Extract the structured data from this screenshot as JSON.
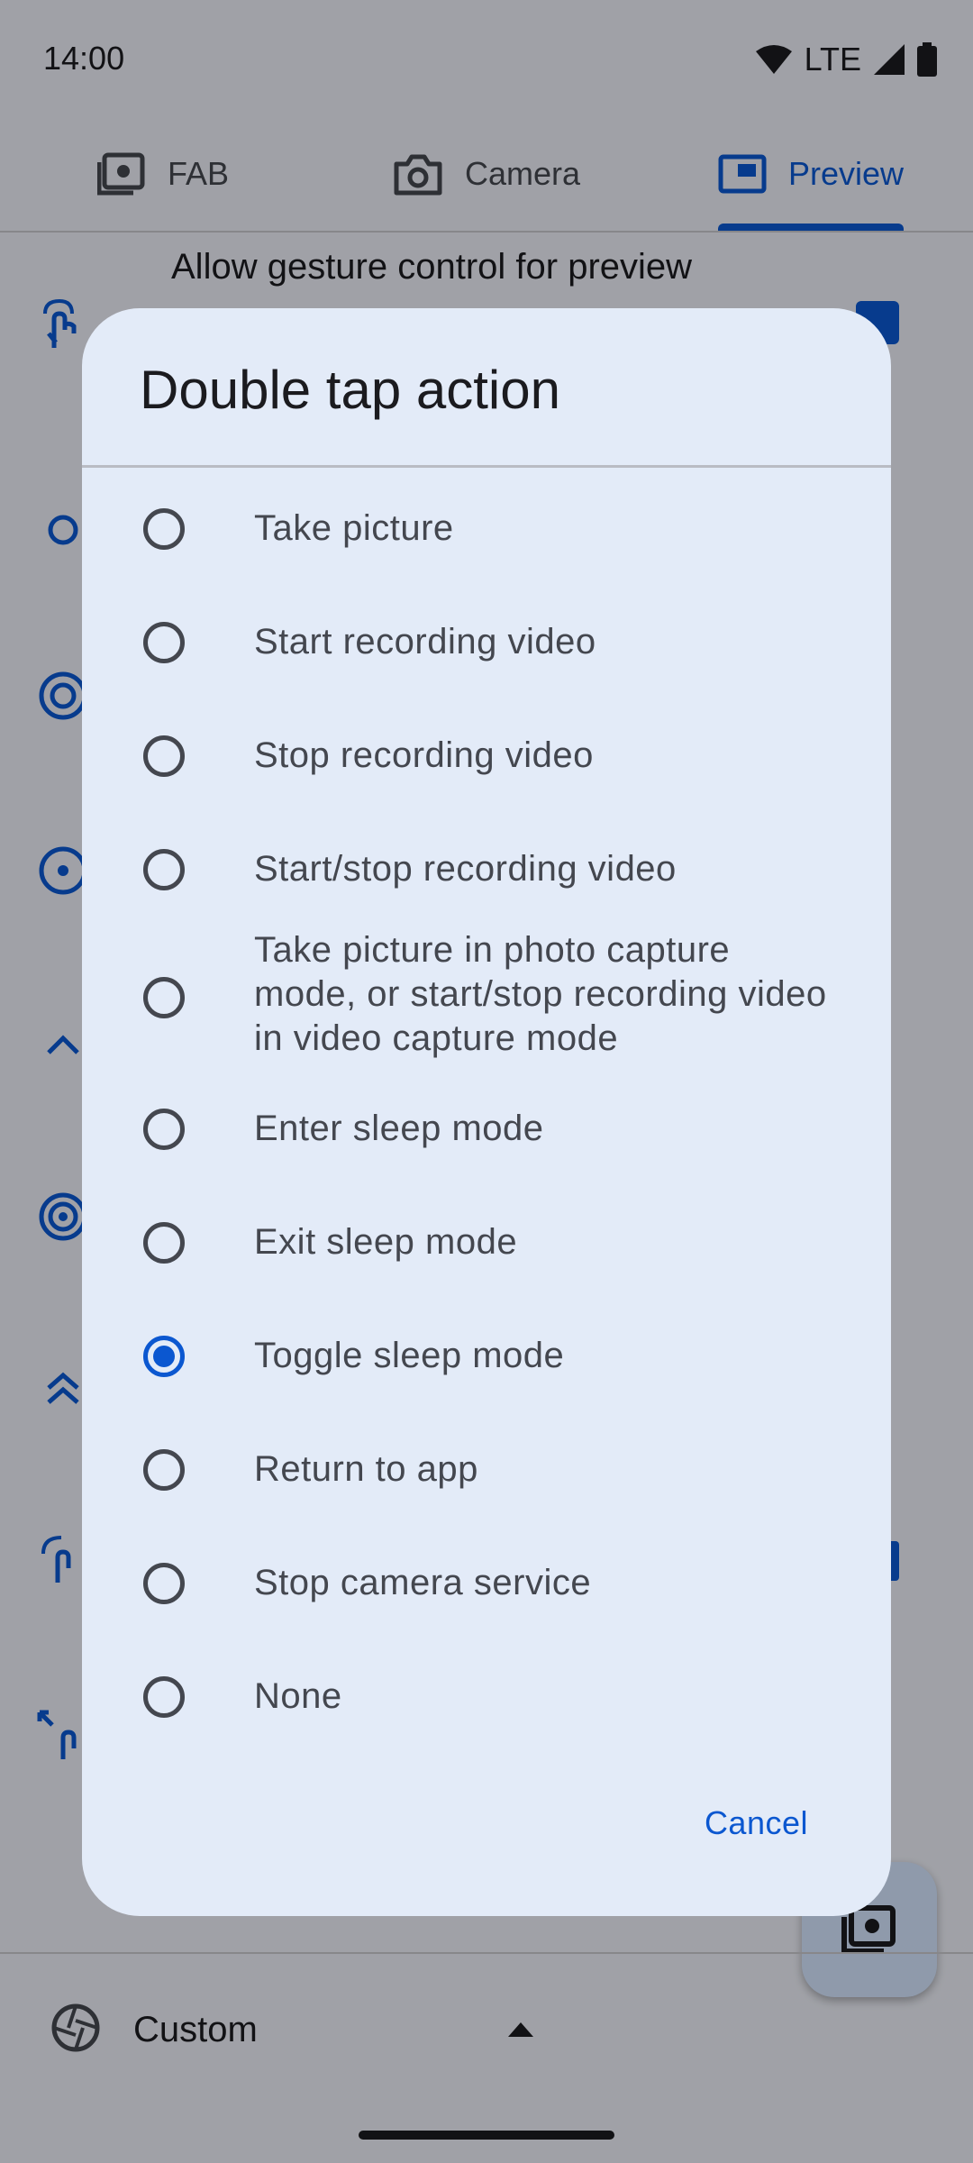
{
  "status_bar": {
    "time": "14:00",
    "network": "LTE"
  },
  "tabs": [
    {
      "label": "FAB",
      "active": false,
      "icon": "camera-frame-icon"
    },
    {
      "label": "Camera",
      "active": false,
      "icon": "camera-icon"
    },
    {
      "label": "Preview",
      "active": true,
      "icon": "picture-in-picture-icon"
    }
  ],
  "background": {
    "section_heading": "Allow gesture control for preview",
    "bottom_selector_label": "Custom"
  },
  "dialog": {
    "title": "Double tap action",
    "options": [
      {
        "label": "Take picture",
        "selected": false
      },
      {
        "label": "Start recording video",
        "selected": false
      },
      {
        "label": "Stop recording video",
        "selected": false
      },
      {
        "label": "Start/stop recording video",
        "selected": false
      },
      {
        "label": "Take picture in photo capture mode, or start/stop recording video in video capture mode",
        "selected": false
      },
      {
        "label": "Enter sleep mode",
        "selected": false
      },
      {
        "label": "Exit sleep mode",
        "selected": false
      },
      {
        "label": "Toggle sleep mode",
        "selected": true
      },
      {
        "label": "Return to app",
        "selected": false
      },
      {
        "label": "Stop camera service",
        "selected": false
      },
      {
        "label": "None",
        "selected": false
      }
    ],
    "cancel_label": "Cancel"
  },
  "colors": {
    "accent": "#0b57d0",
    "dialog_bg": "#e3ebf8",
    "text_secondary": "#44474f"
  }
}
